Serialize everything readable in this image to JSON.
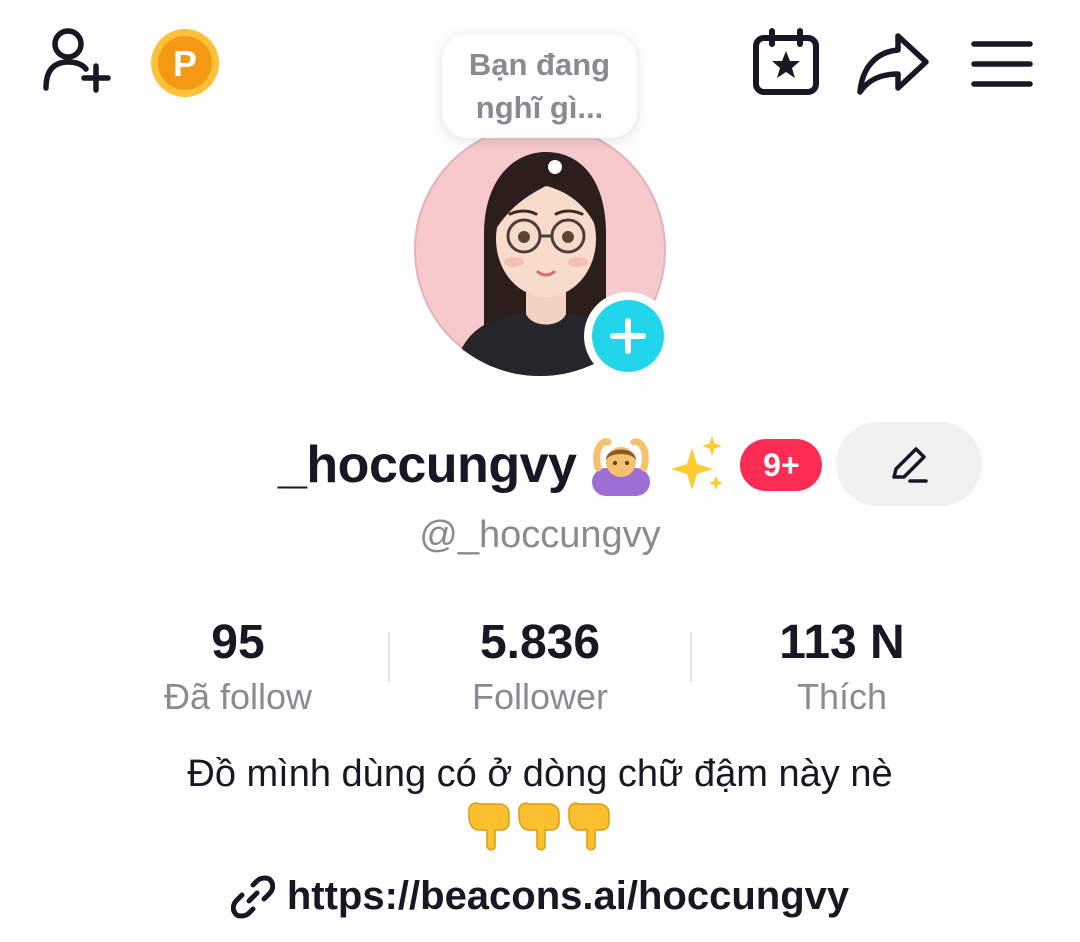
{
  "top_bar": {
    "icons": [
      "add-user-icon",
      "coin-icon",
      "calendar-star-icon",
      "share-icon",
      "menu-icon"
    ],
    "coin_letter": "P"
  },
  "bubble": {
    "text": "Bạn đang nghĩ gì..."
  },
  "profile": {
    "display_name": "_hoccungvy",
    "name_emojis": [
      "person-gesturing-ok",
      "sparkles"
    ],
    "badge": "9+",
    "username": "@_hoccungvy"
  },
  "stats": [
    {
      "value": "95",
      "label": "Đã follow"
    },
    {
      "value": "5.836",
      "label": "Follower"
    },
    {
      "value": "113 N",
      "label": "Thích"
    }
  ],
  "bio": {
    "text": "Đồ mình dùng có ở dòng chữ đậm này nè",
    "emojis": [
      "pointing-down",
      "pointing-down",
      "pointing-down"
    ]
  },
  "link": {
    "text": "https://beacons.ai/hoccungvy"
  },
  "colors": {
    "accent_red": "#fe2c55",
    "accent_cyan": "#20d5ec",
    "coin_orange": "#f5a623",
    "avatar_bg": "#f6c9cc",
    "text_primary": "#161823",
    "text_secondary": "#8a8b91"
  }
}
